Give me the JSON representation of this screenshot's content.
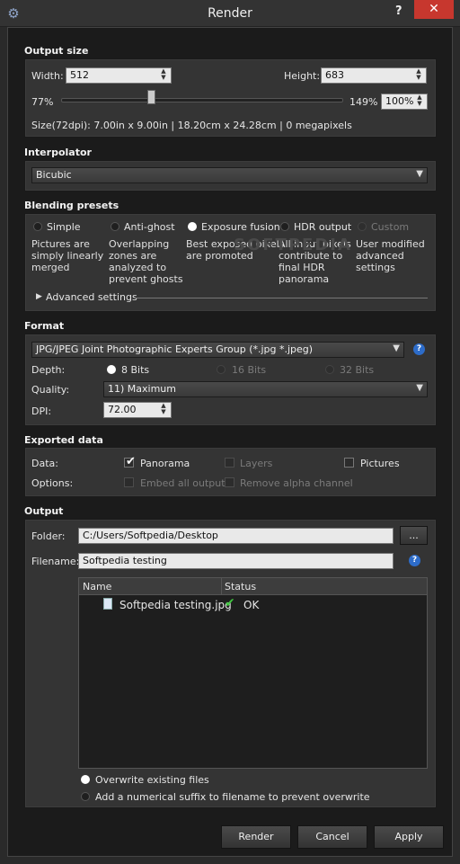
{
  "window": {
    "title": "Render",
    "help_glyph": "?",
    "close_glyph": "✕"
  },
  "output_size": {
    "heading": "Output size",
    "width_label": "Width:",
    "width_value": "512",
    "height_label": "Height:",
    "height_value": "683",
    "scale_min": "77%",
    "scale_max": "149%",
    "scale_value": "100%",
    "scale_fraction": 0.32,
    "size_info": "Size(72dpi):  7.00in x  9.00in | 18.20cm x 24.28cm | 0 megapixels"
  },
  "interpolator": {
    "heading": "Interpolator",
    "value": "Bicubic"
  },
  "blending": {
    "heading": "Blending presets",
    "presets": [
      {
        "label": "Simple",
        "desc": [
          "Pictures are",
          "simply linearly",
          "merged"
        ],
        "selected": false,
        "enabled": true
      },
      {
        "label": "Anti-ghost",
        "desc": [
          "Overlapping",
          "zones are",
          "analyzed to",
          "prevent ghosts"
        ],
        "selected": false,
        "enabled": true
      },
      {
        "label": "Exposure fusion",
        "desc": [
          "Best exposed pixels",
          "are promoted"
        ],
        "selected": true,
        "enabled": true
      },
      {
        "label": "HDR output",
        "desc": [
          "All input pixels",
          "contribute to",
          "final HDR",
          "panorama"
        ],
        "selected": false,
        "enabled": true
      },
      {
        "label": "Custom",
        "desc": [
          "User modified",
          "advanced",
          "settings"
        ],
        "selected": false,
        "enabled": false
      }
    ],
    "advanced_label": "Advanced settings"
  },
  "format": {
    "heading": "Format",
    "value": "JPG/JPEG Joint Photographic Experts Group (*.jpg *.jpeg)",
    "depth_label": "Depth:",
    "depth_options": [
      "8 Bits",
      "16 Bits",
      "32 Bits"
    ],
    "quality_label": "Quality:",
    "quality_value": "11) Maximum",
    "dpi_label": "DPI:",
    "dpi_value": "72.00",
    "help_glyph": "?"
  },
  "exported": {
    "heading": "Exported data",
    "data_label": "Data:",
    "options_label": "Options:",
    "panorama": "Panorama",
    "layers": "Layers",
    "pictures": "Pictures",
    "embed": "Embed all outputs",
    "remove_alpha": "Remove alpha channel"
  },
  "output": {
    "heading": "Output",
    "folder_label": "Folder:",
    "folder_value": "C:/Users/Softpedia/Desktop",
    "browse_label": "...",
    "filename_label": "Filename:",
    "filename_value": "Softpedia testing",
    "help_glyph": "?",
    "columns": [
      "Name",
      "Status"
    ],
    "files": [
      {
        "name": "Softpedia testing.jpg",
        "status": "OK"
      }
    ],
    "overwrite_label": "Overwrite existing files",
    "suffix_label": "Add a numerical suffix to filename to prevent overwrite"
  },
  "buttons": {
    "render": "Render",
    "cancel": "Cancel",
    "apply": "Apply"
  },
  "watermark": "SOFTPEDIA"
}
